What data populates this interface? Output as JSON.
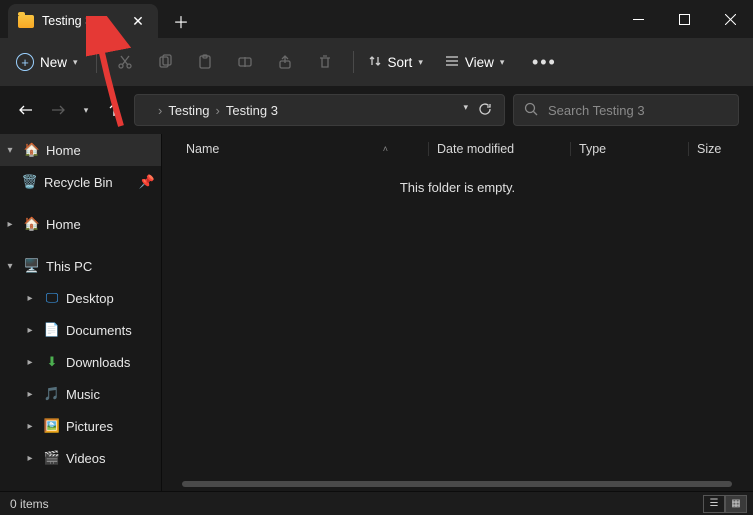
{
  "tab": {
    "title": "Testing 3"
  },
  "toolbar": {
    "new_label": "New",
    "sort_label": "Sort",
    "view_label": "View"
  },
  "breadcrumbs": [
    "Testing",
    "Testing 3"
  ],
  "search": {
    "placeholder": "Search Testing 3"
  },
  "columns": {
    "name": "Name",
    "date": "Date modified",
    "type": "Type",
    "size": "Size"
  },
  "empty_message": "This folder is empty.",
  "tree": {
    "home": "Home",
    "recycle": "Recycle Bin",
    "home2": "Home",
    "thispc": "This PC",
    "desktop": "Desktop",
    "documents": "Documents",
    "downloads": "Downloads",
    "music": "Music",
    "pictures": "Pictures",
    "videos": "Videos"
  },
  "status": {
    "items": "0 items"
  }
}
